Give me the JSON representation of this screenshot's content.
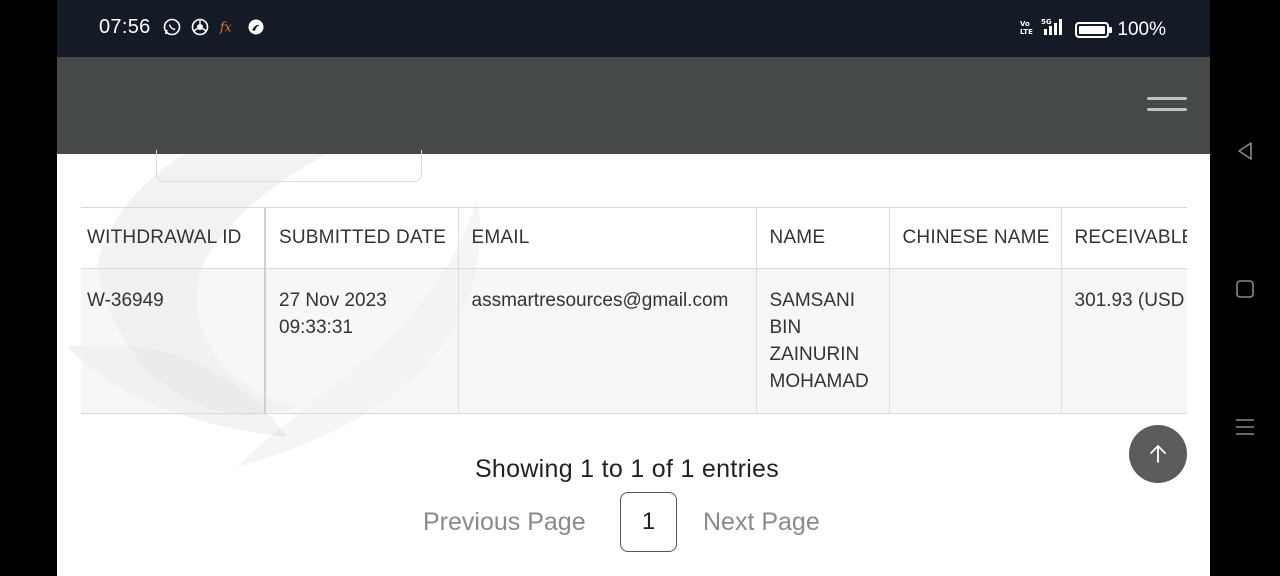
{
  "status_bar": {
    "time": "07:56",
    "left_icons": [
      "whatsapp-icon",
      "chrome-icon",
      "fx-icon",
      "browser-icon"
    ],
    "network_label": "5G",
    "battery": "100%"
  },
  "table": {
    "headers": [
      "WITHDRAWAL ID",
      "SUBMITTED DATE",
      "EMAIL",
      "NAME",
      "CHINESE NAME",
      "RECEIVABLE"
    ],
    "rows": [
      {
        "withdrawal_id": "W-36949",
        "submitted_date_line1": "27 Nov 2023",
        "submitted_date_line2": "09:33:31",
        "email": "assmartresources@gmail.com",
        "name_lines": [
          "SAMSANI",
          "BIN",
          "ZAINURIN",
          "MOHAMAD"
        ],
        "chinese_name": "",
        "receivable": "301.93 (USD"
      }
    ]
  },
  "pagination": {
    "info": "Showing 1 to 1 of 1 entries",
    "previous": "Previous Page",
    "current": "1",
    "next": "Next Page"
  },
  "colors": {
    "status_bar": "#141a26",
    "header": "#454a47",
    "scroll_top_button": "#5c5c5c"
  }
}
